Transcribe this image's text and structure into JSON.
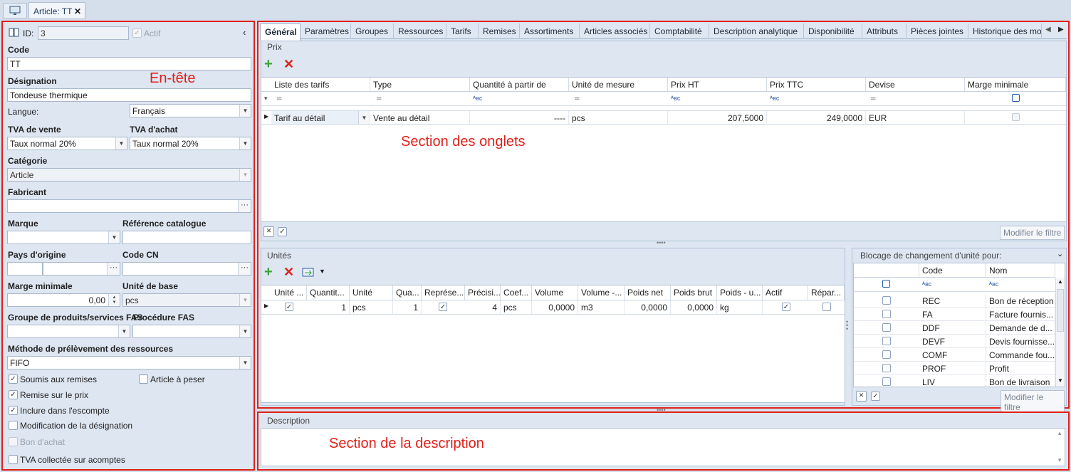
{
  "window_tab": {
    "title": "Article: TT",
    "close": "✕"
  },
  "header": {
    "id_label": "ID:",
    "id_value": "3",
    "actif_label": "Actif",
    "code_label": "Code",
    "code_value": "TT",
    "designation_label": "Désignation",
    "designation_value": "Tondeuse thermique",
    "langue_label": "Langue:",
    "langue_value": "Français",
    "tva_vente_label": "TVA de vente",
    "tva_vente_value": "Taux normal 20%",
    "tva_achat_label": "TVA d'achat",
    "tva_achat_value": "Taux normal 20%",
    "categorie_label": "Catégorie",
    "categorie_value": "Article",
    "fabricant_label": "Fabricant",
    "fabricant_value": "",
    "marque_label": "Marque",
    "marque_value": "",
    "ref_catalogue_label": "Référence catalogue",
    "ref_catalogue_value": "",
    "pays_label": "Pays d'origine",
    "code_cn_label": "Code CN",
    "marge_min_label": "Marge minimale",
    "marge_min_value": "0,00",
    "unite_base_label": "Unité de base",
    "unite_base_value": "pcs",
    "groupe_fas_label": "Groupe de produits/services FAS",
    "procedure_fas_label": "Procédure FAS",
    "methode_label": "Méthode de prélèvement des ressources",
    "methode_value": "FIFO",
    "checkboxes": [
      {
        "label": "Soumis aux remises",
        "checked": true,
        "disabled": false
      },
      {
        "label": "Remise sur le prix",
        "checked": true,
        "disabled": false
      },
      {
        "label": "Inclure dans l'escompte",
        "checked": true,
        "disabled": false
      },
      {
        "label": "Modification de la désignation",
        "checked": false,
        "disabled": false
      },
      {
        "label": "Bon d'achat",
        "checked": false,
        "disabled": true
      },
      {
        "label": "TVA collectée sur acomptes",
        "checked": false,
        "disabled": false
      }
    ],
    "article_a_peser": "Article à peser"
  },
  "tabs": [
    "Général",
    "Paramètres",
    "Groupes",
    "Ressources",
    "Tarifs",
    "Remises",
    "Assortiments",
    "Articles associés",
    "Comptabilité",
    "Description analytique",
    "Disponibilité",
    "Attributs",
    "Pièces jointes",
    "Historique des mod"
  ],
  "prix": {
    "title": "Prix",
    "columns": [
      "Liste des tarifs",
      "Type",
      "Quantité à partir de",
      "Unité de mesure",
      "Prix HT",
      "Prix TTC",
      "Devise",
      "Marge minimale"
    ],
    "row": [
      "Tarif au détail",
      "Vente au détail",
      "----",
      "pcs",
      "207,5000",
      "249,0000",
      "EUR",
      ""
    ],
    "modifier_filtre": "Modifier le filtre"
  },
  "unites": {
    "title": "Unités",
    "columns": [
      "Unité ...",
      "Quantit...",
      "Unité",
      "Qua...",
      "Représe...",
      "Précisi...",
      "Coef...",
      "Volume",
      "Volume -...",
      "Poids net",
      "Poids brut",
      "Poids - u...",
      "Actif",
      "Répar..."
    ],
    "row": [
      "",
      "1",
      "pcs",
      "1",
      "",
      "4",
      "pcs",
      "0,0000",
      "m3",
      "0,0000",
      "0,0000",
      "kg",
      "",
      ""
    ]
  },
  "blocage": {
    "title": "Blocage de changement d'unité pour:",
    "columns": [
      "Code",
      "Nom"
    ],
    "rows": [
      {
        "code": "REC",
        "nom": "Bon de réception"
      },
      {
        "code": "FA",
        "nom": "Facture fournis..."
      },
      {
        "code": "DDF",
        "nom": "Demande de d..."
      },
      {
        "code": "DEVF",
        "nom": "Devis fournisse..."
      },
      {
        "code": "COMF",
        "nom": "Commande fou..."
      },
      {
        "code": "PROF",
        "nom": "Profit"
      },
      {
        "code": "LIV",
        "nom": "Bon de livraison"
      }
    ],
    "modifier_filtre": "Modifier le filtre"
  },
  "description": {
    "title": "Description"
  },
  "annotations": {
    "entete": "En-tête",
    "onglets": "Section des onglets",
    "description": "Section de la description"
  },
  "colors": {
    "annotation": "#e0201a",
    "background": "#d5dfec"
  }
}
